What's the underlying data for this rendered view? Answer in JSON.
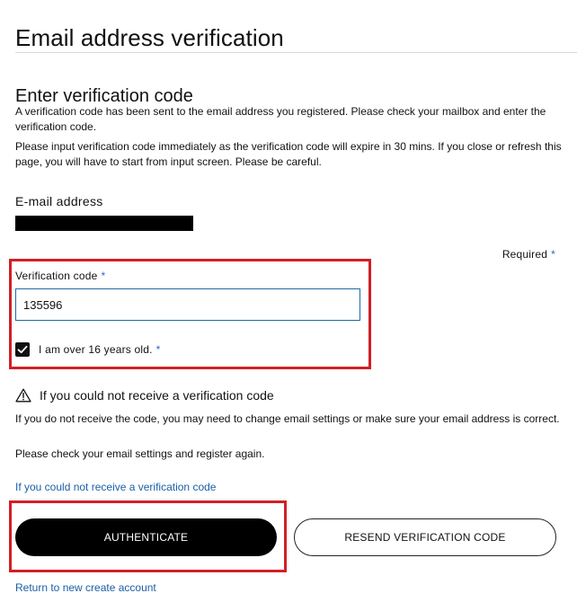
{
  "page": {
    "title": "Email address verification",
    "section_title": "Enter verification code",
    "intro_1": "A verification code has been sent to the email address you registered. Please check your mailbox and enter the verification code.",
    "intro_2": "Please input verification code immediately as the verification code will expire in 30 mins. If you close or refresh this page, you will have to start from input screen. Please be careful."
  },
  "email": {
    "label": "E-mail address",
    "value_redacted": true
  },
  "form": {
    "required_note": "Required",
    "required_marker": "*",
    "code_label": "Verification code",
    "code_value": "135596",
    "age_checkbox_label": "I am over 16 years old.",
    "age_checked": true
  },
  "help": {
    "title": "If you could not receive a verification code",
    "text_1": "If you do not receive the code, you may need to change email settings or make sure your email address is correct.",
    "text_2": "Please check your email settings and register again.",
    "link": "If you could not receive a verification code"
  },
  "actions": {
    "authenticate": "AUTHENTICATE",
    "resend": "RESEND VERIFICATION CODE",
    "return_link": "Return to new create account"
  },
  "colors": {
    "highlight": "#d21f26",
    "link": "#1b5fa6",
    "required_star": "#1a6ec9",
    "input_border": "#1c6aa6"
  },
  "icons": {
    "warning": "warning-triangle-icon",
    "checkbox": "checkmark-icon"
  }
}
